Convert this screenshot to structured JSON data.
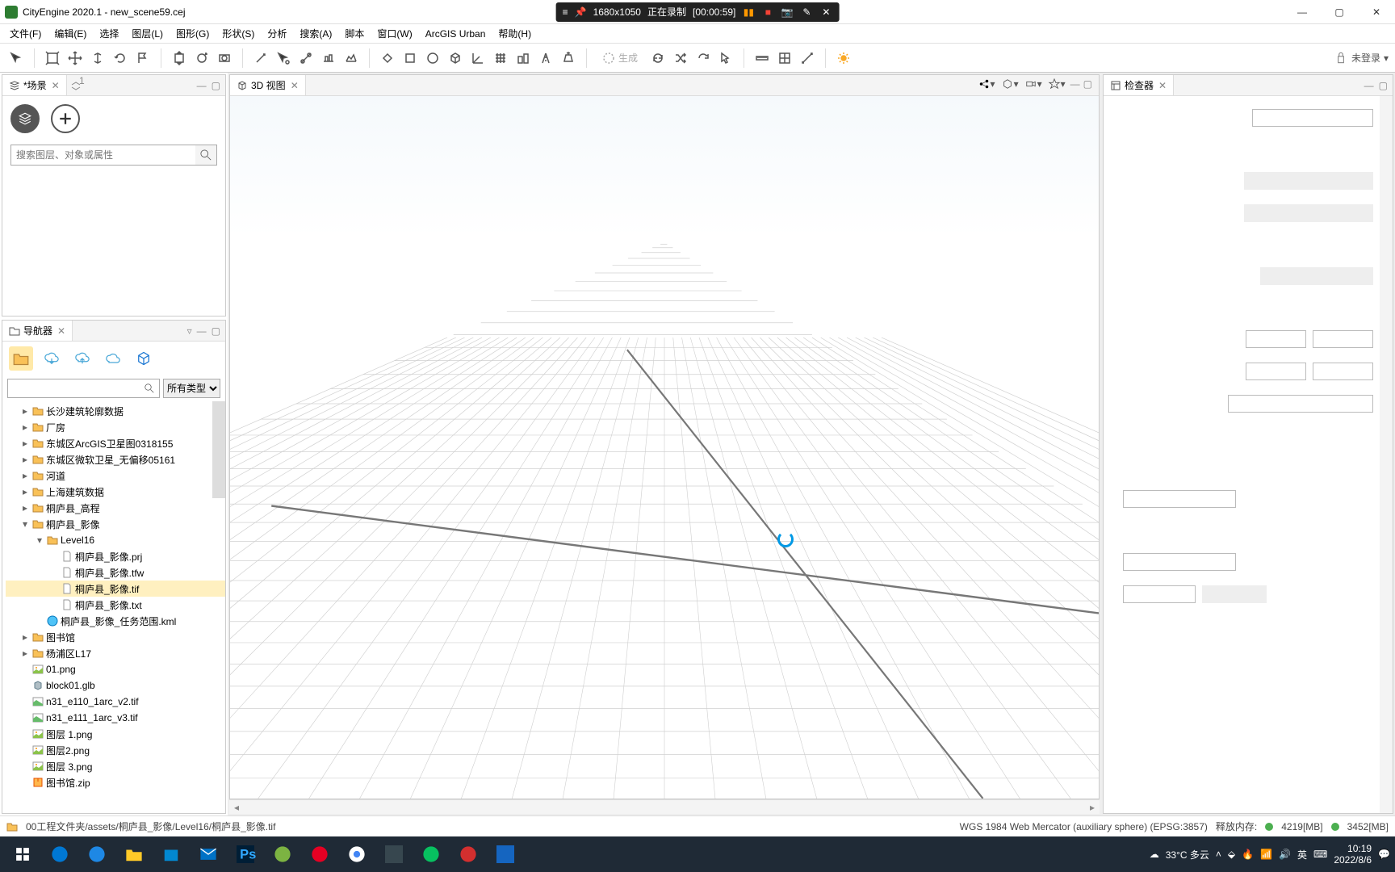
{
  "title_app": "CityEngine 2020.1",
  "title_file": "new_scene59.cej",
  "title_sep": " - ",
  "recorder": {
    "res": "1680x1050",
    "label": "正在录制",
    "time": "[00:00:59]"
  },
  "menus": [
    "文件(F)",
    "编辑(E)",
    "选择",
    "图层(L)",
    "图形(G)",
    "形状(S)",
    "分析",
    "搜索(A)",
    "脚本",
    "窗口(W)",
    "ArcGIS Urban",
    "帮助(H)"
  ],
  "toolbar": {
    "generate_label": "生成",
    "login_label": "未登录",
    "login_caret": "▾"
  },
  "scene_panel": {
    "tab": "*场景",
    "search_placeholder": "搜索图层、对象或属性"
  },
  "nav_panel": {
    "tab": "导航器",
    "filter": "所有类型",
    "tree": [
      {
        "depth": 0,
        "tw": "▸",
        "icon": "folder",
        "label": "长沙建筑轮廓数据"
      },
      {
        "depth": 0,
        "tw": "▸",
        "icon": "folder",
        "label": "厂房"
      },
      {
        "depth": 0,
        "tw": "▸",
        "icon": "folder",
        "label": "东城区ArcGIS卫星图0318155"
      },
      {
        "depth": 0,
        "tw": "▸",
        "icon": "folder",
        "label": "东城区微软卫星_无偏移05161"
      },
      {
        "depth": 0,
        "tw": "▸",
        "icon": "folder",
        "label": "河道"
      },
      {
        "depth": 0,
        "tw": "▸",
        "icon": "folder",
        "label": "上海建筑数据"
      },
      {
        "depth": 0,
        "tw": "▸",
        "icon": "folder",
        "label": "桐庐县_高程"
      },
      {
        "depth": 0,
        "tw": "▾",
        "icon": "folder",
        "label": "桐庐县_影像"
      },
      {
        "depth": 1,
        "tw": "▾",
        "icon": "folder",
        "label": "Level16"
      },
      {
        "depth": 2,
        "tw": "",
        "icon": "file",
        "label": "桐庐县_影像.prj"
      },
      {
        "depth": 2,
        "tw": "",
        "icon": "file",
        "label": "桐庐县_影像.tfw"
      },
      {
        "depth": 2,
        "tw": "",
        "icon": "file",
        "label": "桐庐县_影像.tif",
        "sel": true
      },
      {
        "depth": 2,
        "tw": "",
        "icon": "file",
        "label": "桐庐县_影像.txt"
      },
      {
        "depth": 1,
        "tw": "",
        "icon": "kml",
        "label": "桐庐县_影像_任务范围.kml"
      },
      {
        "depth": 0,
        "tw": "▸",
        "icon": "folder",
        "label": "图书馆"
      },
      {
        "depth": 0,
        "tw": "▸",
        "icon": "folder",
        "label": "杨浦区L17"
      },
      {
        "depth": 0,
        "tw": "",
        "icon": "img",
        "label": "01.png"
      },
      {
        "depth": 0,
        "tw": "",
        "icon": "glb",
        "label": "block01.glb"
      },
      {
        "depth": 0,
        "tw": "",
        "icon": "tif",
        "label": "n31_e110_1arc_v2.tif"
      },
      {
        "depth": 0,
        "tw": "",
        "icon": "tif",
        "label": "n31_e111_1arc_v3.tif"
      },
      {
        "depth": 0,
        "tw": "",
        "icon": "img",
        "label": "图层 1.png"
      },
      {
        "depth": 0,
        "tw": "",
        "icon": "img",
        "label": "图层2.png"
      },
      {
        "depth": 0,
        "tw": "",
        "icon": "img",
        "label": "图层 3.png"
      },
      {
        "depth": 0,
        "tw": "",
        "icon": "zip",
        "label": "图书馆.zip"
      }
    ]
  },
  "viewport": {
    "tab": "3D 视图"
  },
  "inspector": {
    "tab": "检查器"
  },
  "statusbar": {
    "path": "00工程文件夹/assets/桐庐县_影像/Level16/桐庐县_影像.tif",
    "crs": "WGS 1984 Web Mercator (auxiliary sphere) (EPSG:3857)",
    "mem_label": "释放内存:",
    "mem1": "4219[MB]",
    "mem2": "3452[MB]"
  },
  "tray": {
    "weather": "33°C 多云",
    "ime": "英",
    "time": "10:19",
    "date": "2022/8/6"
  }
}
